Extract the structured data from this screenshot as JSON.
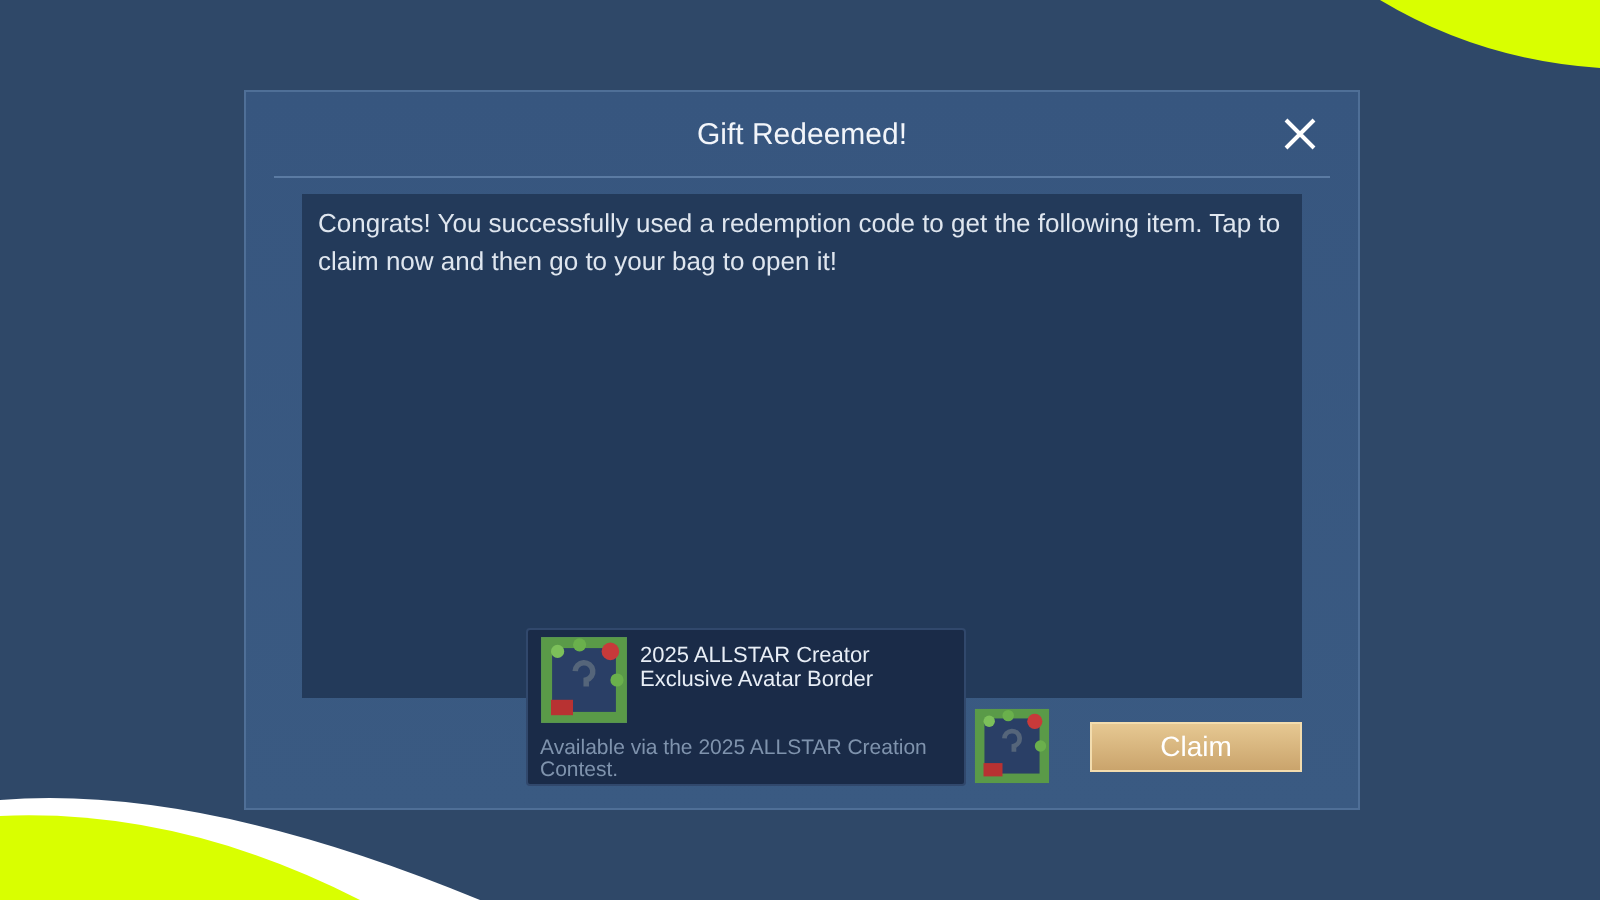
{
  "dialog": {
    "title": "Gift Redeemed!",
    "message": "Congrats! You successfully used a redemption code to get the following item. Tap to claim now and then go to your bag to open it!",
    "claim_button": "Claim"
  },
  "item_tooltip": {
    "name": "2025 ALLSTAR Creator Exclusive Avatar Border",
    "description": "Available via the 2025 ALLSTAR Creation Contest."
  }
}
